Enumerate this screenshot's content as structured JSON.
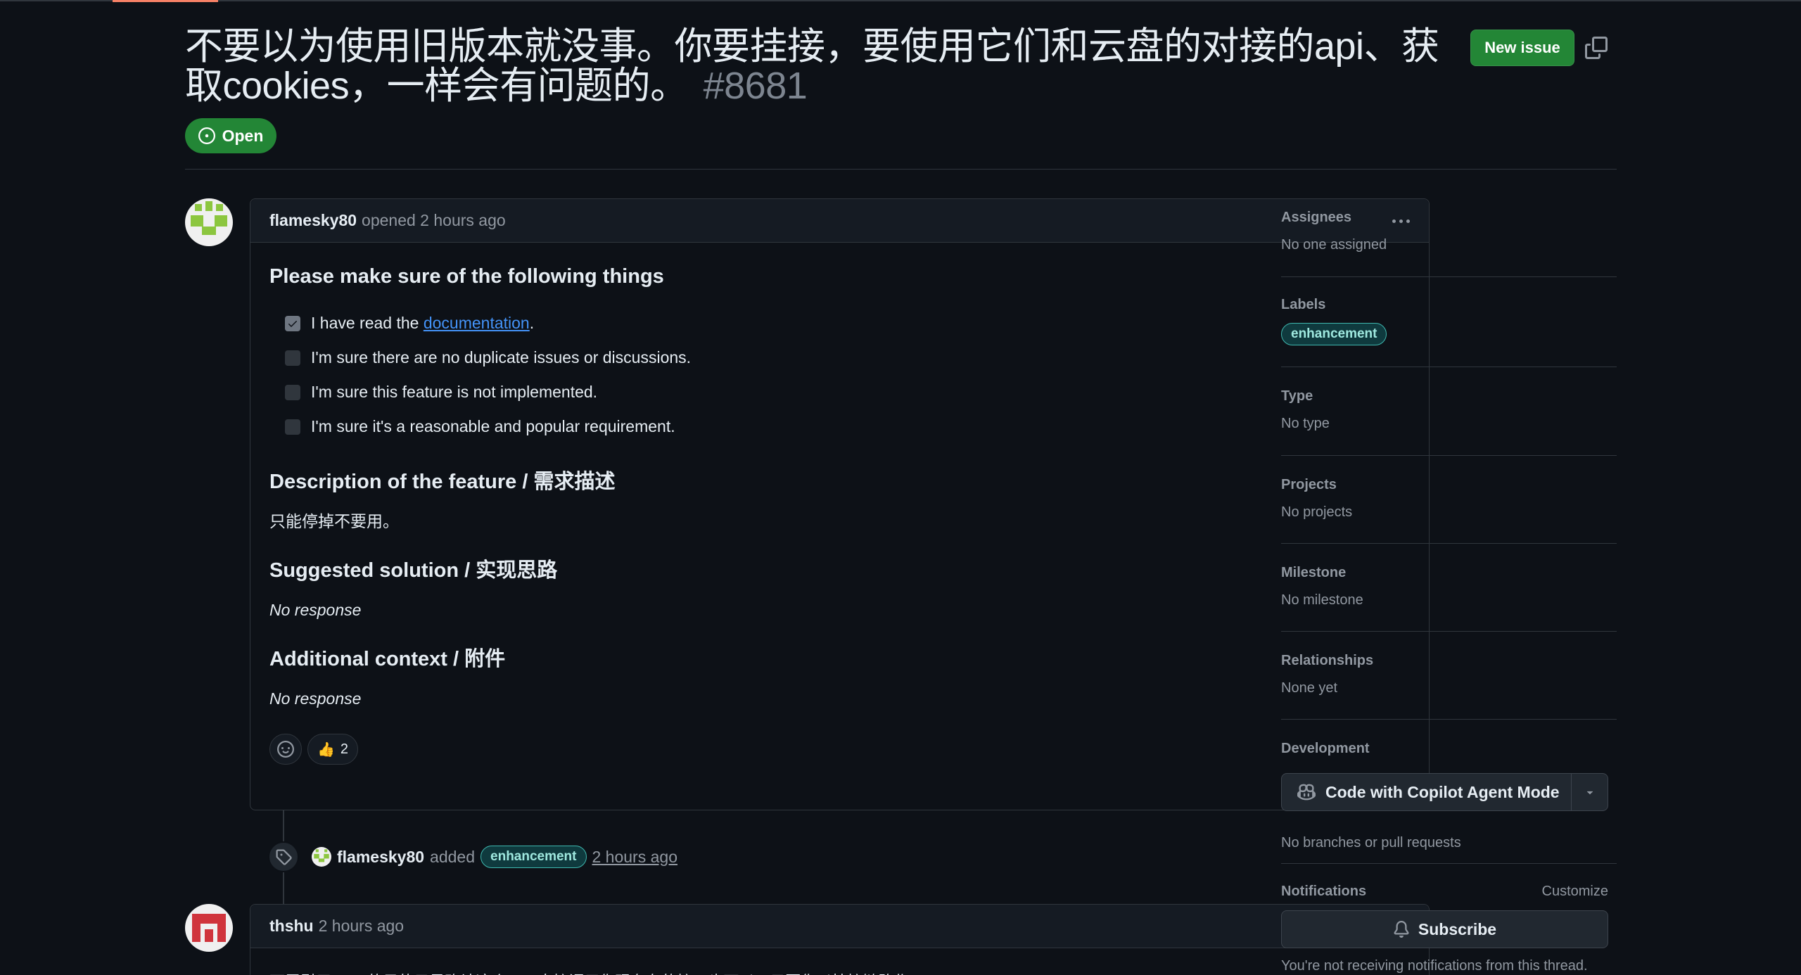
{
  "issue": {
    "title": "不要以为使用旧版本就没事。你要挂接，要使用它们和云盘的对接的api、获取cookies，一样会有问题的。",
    "number": "#8681",
    "state": "Open"
  },
  "header": {
    "new_issue_label": "New issue"
  },
  "comment": {
    "author": "flamesky80",
    "meta": "opened 2 hours ago",
    "heading": "Please make sure of the following things",
    "checklist": [
      {
        "pre": "I have read the ",
        "link": "documentation",
        "post": ".",
        "checked": true
      },
      {
        "text": "I'm sure there are no duplicate issues or discussions.",
        "checked": false
      },
      {
        "text": "I'm sure this feature is not implemented.",
        "checked": false
      },
      {
        "text": "I'm sure it's a reasonable and popular requirement.",
        "checked": false
      }
    ],
    "sections": [
      {
        "heading": "Description of the feature / 需求描述",
        "body": "只能停掉不要用。",
        "italic": false
      },
      {
        "heading": "Suggested solution / 实现思路",
        "body": "No response",
        "italic": true
      },
      {
        "heading": "Additional context / 附件",
        "body": "No response",
        "italic": true
      }
    ],
    "reaction": {
      "emoji": "👍",
      "count": "2"
    }
  },
  "timeline_event": {
    "author": "flamesky80",
    "action": "added",
    "label": "enhancement",
    "time": "2 hours ago"
  },
  "comment2": {
    "author": "thshu",
    "meta": "2 hours ago",
    "partial_text": "下层引用api，的目的只是确认这个——直接调用你现有存的接口也可以。只要你以挂接链路作..."
  },
  "sidebar": {
    "assignees": {
      "heading": "Assignees",
      "value": "No one assigned"
    },
    "labels": {
      "heading": "Labels",
      "value": "enhancement"
    },
    "type": {
      "heading": "Type",
      "value": "No type"
    },
    "projects": {
      "heading": "Projects",
      "value": "No projects"
    },
    "milestone": {
      "heading": "Milestone",
      "value": "No milestone"
    },
    "relationships": {
      "heading": "Relationships",
      "value": "None yet"
    },
    "development": {
      "heading": "Development",
      "button": "Code with Copilot Agent Mode",
      "value": "No branches or pull requests"
    },
    "notifications": {
      "heading": "Notifications",
      "customize": "Customize",
      "button": "Subscribe",
      "value": "You're not receiving notifications from this thread."
    }
  },
  "colors": {
    "background": "#0d1117",
    "accent_green": "#238636",
    "link_blue": "#4493f8",
    "label_teal": "#3fb9b0"
  }
}
